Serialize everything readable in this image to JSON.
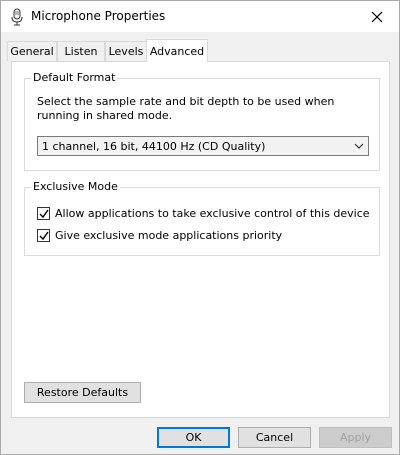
{
  "window": {
    "title": "Microphone Properties",
    "icon": "microphone-icon",
    "close_icon": "close-icon"
  },
  "tabs": [
    {
      "label": "General",
      "active": false
    },
    {
      "label": "Listen",
      "active": false
    },
    {
      "label": "Levels",
      "active": false
    },
    {
      "label": "Advanced",
      "active": true
    }
  ],
  "default_format": {
    "title": "Default Format",
    "description": "Select the sample rate and bit depth to be used when running in shared mode.",
    "selected": "1 channel, 16 bit, 44100 Hz (CD Quality)"
  },
  "exclusive_mode": {
    "title": "Exclusive Mode",
    "options": [
      {
        "label": "Allow applications to take exclusive control of this device",
        "checked": true
      },
      {
        "label": "Give exclusive mode applications priority",
        "checked": true
      }
    ]
  },
  "restore_defaults": "Restore Defaults",
  "buttons": {
    "ok": "OK",
    "cancel": "Cancel",
    "apply": "Apply"
  }
}
